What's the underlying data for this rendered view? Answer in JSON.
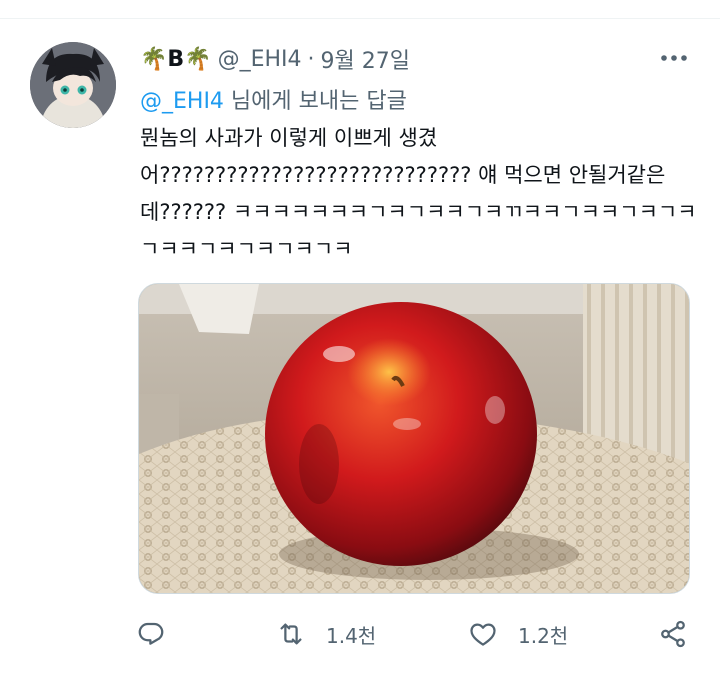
{
  "tweet": {
    "author_name": "🌴B🌴",
    "handle": "@_EHI4",
    "separator": "·",
    "date": "9월 27일",
    "replying_mention": "@_EHI4",
    "replying_suffix": " 님에게 보내는 답글",
    "text": "뭔놈의 사과가 이렇게 이쁘게 생겼어???????????????????????????? 얘 먹으면 안될거같은데?????? ㅋㅋㅋㅋㅋㅋㅋㄱㅋㄱㅋㅋㄱㅋㄲㅋㅋㄱㅋㅋㄱㅋㄱㅋㄱㅋㅋㄱㅋㄱㅋㄱㅋㄱㅋ"
  },
  "actions": {
    "retweet_count": "1.4천",
    "like_count": "1.2천"
  },
  "icons": {
    "more": "more-horizontal-icon",
    "reply": "reply-icon",
    "retweet": "retweet-icon",
    "like": "heart-icon",
    "share": "share-icon"
  },
  "colors": {
    "link": "#1d9bf0",
    "secondary_text": "#536471",
    "apple": "#c8141a"
  }
}
